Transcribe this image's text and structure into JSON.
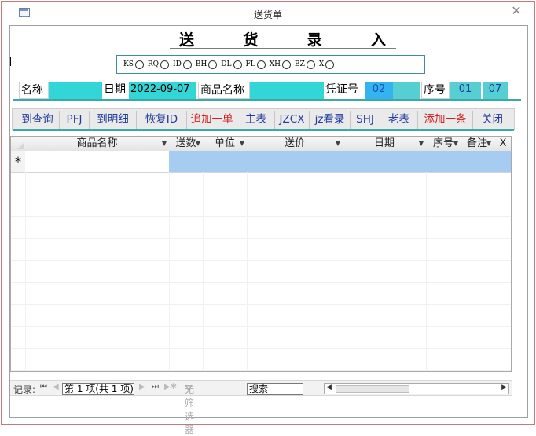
{
  "window": {
    "title": "送货单"
  },
  "header": {
    "chars": [
      "送",
      "货",
      "录",
      "入"
    ]
  },
  "options": [
    "KS",
    "RQ",
    "ID",
    "BH",
    "DL",
    "FL",
    "XH",
    "BZ",
    "X"
  ],
  "fields": {
    "name_label": "名称",
    "name_value": "",
    "date_label": "日期",
    "date_value": "2022-09-07",
    "product_label": "商品名称",
    "product_value": "",
    "voucher_label": "凭证号",
    "voucher_value": "02",
    "voucher_extra": "",
    "seq_label": "序号",
    "seq_value1": "01",
    "seq_value2": "07"
  },
  "buttons": [
    "到查询",
    "PFJ",
    "到明细",
    "恢复ID",
    "追加一单",
    "主表",
    "JZCX",
    "jz看录",
    "SHJ",
    "老表",
    "添加一条",
    "关闭"
  ],
  "grid": {
    "columns": [
      "商品名称",
      "送数",
      "单位",
      "送价",
      "日期",
      "序号",
      "备注",
      "X"
    ],
    "new_row_marker": "*"
  },
  "nav": {
    "record_label": "记录:",
    "first": "⏮",
    "prev": "◀",
    "current": "第 1 项(共 1 项)",
    "next": "▶",
    "last": "⏭",
    "new": "▶✱",
    "filter": "无筛选器",
    "search": "搜索",
    "scroll_left": "◀",
    "scroll_right": "▶"
  },
  "colors": {
    "accent_teal": "#3aa9a9",
    "cyan_field": "#33d6d6",
    "highlight_row": "#a6cdf1",
    "button_text": "#1f3c9e",
    "button_red": "#d02020"
  }
}
